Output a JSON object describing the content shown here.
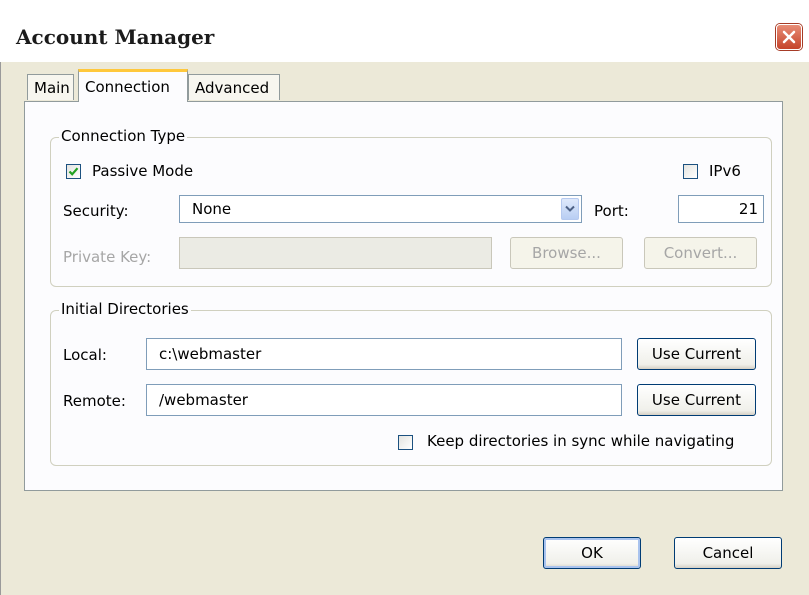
{
  "window": {
    "title": "Account Manager"
  },
  "tabs": [
    {
      "label": "Main"
    },
    {
      "label": "Connection"
    },
    {
      "label": "Advanced"
    }
  ],
  "connection_type": {
    "group_title": "Connection Type",
    "passive_mode": {
      "label": "Passive Mode",
      "checked": true
    },
    "ipv6": {
      "label": "IPv6",
      "checked": false
    },
    "security": {
      "label": "Security:",
      "value": "None"
    },
    "port": {
      "label": "Port:",
      "value": "21"
    },
    "private_key": {
      "label": "Private Key:",
      "value": ""
    },
    "browse_label": "Browse...",
    "convert_label": "Convert..."
  },
  "initial_directories": {
    "group_title": "Initial Directories",
    "local": {
      "label": "Local:",
      "value": "c:\\webmaster",
      "button": "Use Current"
    },
    "remote": {
      "label": "Remote:",
      "value": "/webmaster",
      "button": "Use Current"
    },
    "keep_sync": {
      "label": "Keep directories in sync while navigating",
      "checked": false
    }
  },
  "footer": {
    "ok_label": "OK",
    "cancel_label": "Cancel"
  }
}
